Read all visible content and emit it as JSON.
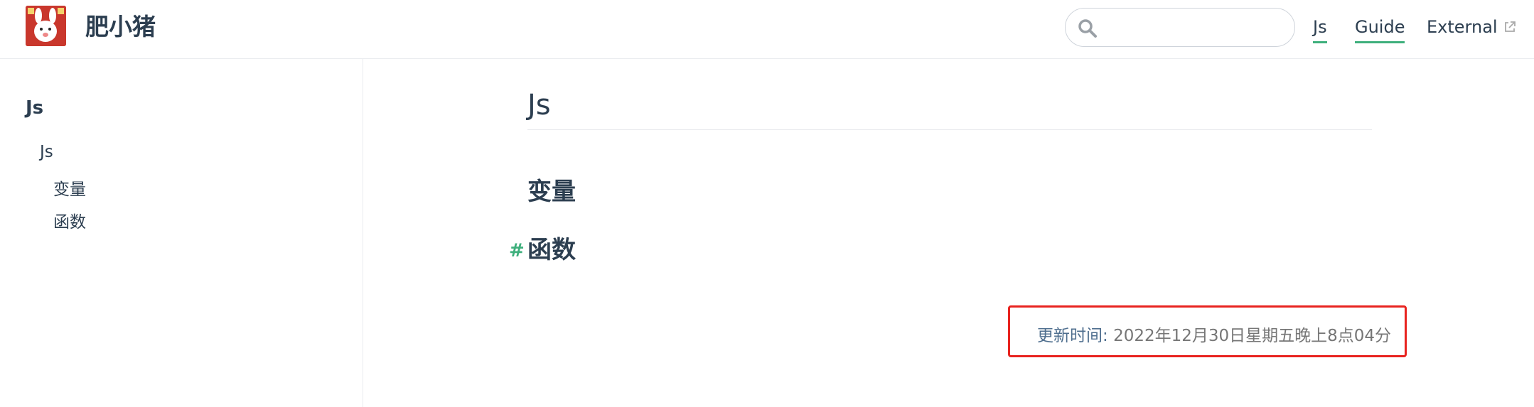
{
  "navbar": {
    "site_name": "肥小猪",
    "search": {
      "placeholder": "",
      "value": ""
    },
    "links": [
      {
        "label": "Js",
        "active": true
      },
      {
        "label": "Guide",
        "active": true
      },
      {
        "label": "External",
        "external": true
      }
    ]
  },
  "sidebar": {
    "heading": "Js",
    "items": [
      {
        "label": "Js"
      },
      {
        "label": "变量"
      },
      {
        "label": "函数"
      }
    ]
  },
  "content": {
    "title": "Js",
    "sections": [
      {
        "heading": "变量"
      },
      {
        "heading": "函数",
        "anchor": "#"
      }
    ],
    "last_updated": {
      "label": "更新时间:",
      "value": "2022年12月30日星期五晚上8点04分"
    }
  },
  "colors": {
    "accent": "#3eaf7c",
    "text": "#2c3e50",
    "highlight_border": "#e8231f"
  }
}
